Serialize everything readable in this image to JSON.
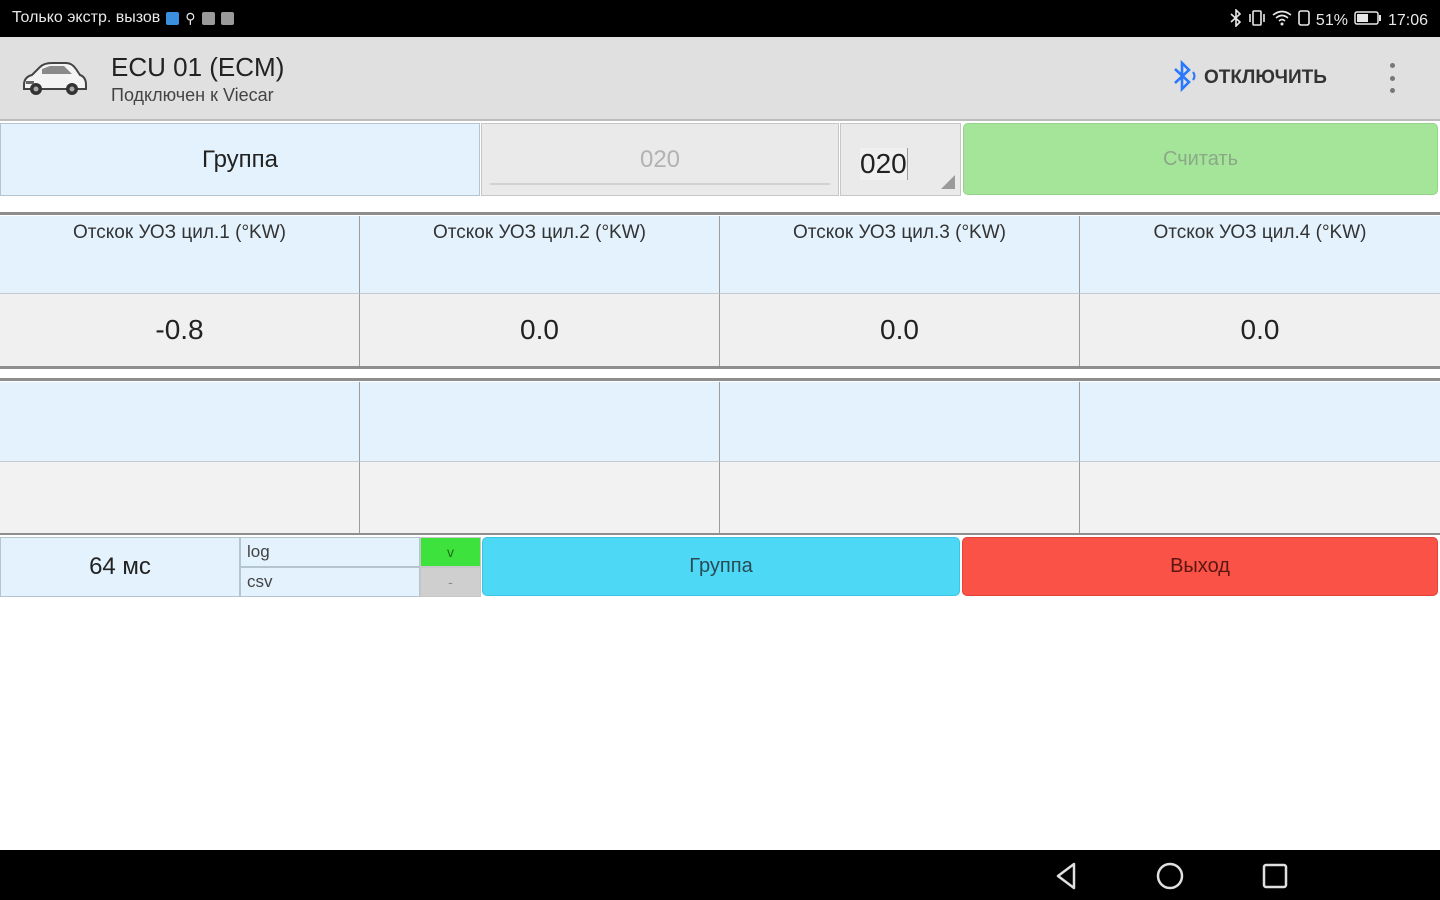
{
  "status_bar": {
    "carrier": "Только экстр. вызов",
    "battery": "51%",
    "time": "17:06",
    "icons": [
      "sim-icon",
      "usb-icon",
      "image-icon",
      "mail-icon",
      "bluetooth-icon",
      "vibrate-icon",
      "wifi-icon",
      "nfc-icon",
      "battery-icon"
    ]
  },
  "app_bar": {
    "title": "ECU 01 (ECM)",
    "subtitle": "Подключен к Viecar",
    "disconnect_label": "ОТКЛЮЧИТЬ",
    "icons": [
      "car-icon",
      "bluetooth-icon",
      "more-vert-icon"
    ],
    "accent": "#2979ff"
  },
  "group_row": {
    "label": "Группа",
    "input_value": "020",
    "selected_group": "020",
    "read_button": "Считать",
    "read_button_color": "#a5e59a"
  },
  "table": {
    "headers": [
      "Отскок УОЗ цил.1 (°KW)",
      "Отскок УОЗ цил.2 (°KW)",
      "Отскок УОЗ цил.3 (°KW)",
      "Отскок УОЗ цил.4 (°KW)"
    ],
    "values": [
      "-0.8",
      "0.0",
      "0.0",
      "0.0"
    ]
  },
  "bottom": {
    "interval": "64 мс",
    "log_label": "log",
    "csv_label": "csv",
    "log_flag": "v",
    "csv_flag": "-",
    "group_button": "Группа",
    "exit_button": "Выход",
    "group_button_color": "#4dd8f5",
    "exit_button_color": "#fa5246"
  },
  "nav": {
    "icons": [
      "back-icon",
      "home-icon",
      "recents-icon"
    ]
  }
}
